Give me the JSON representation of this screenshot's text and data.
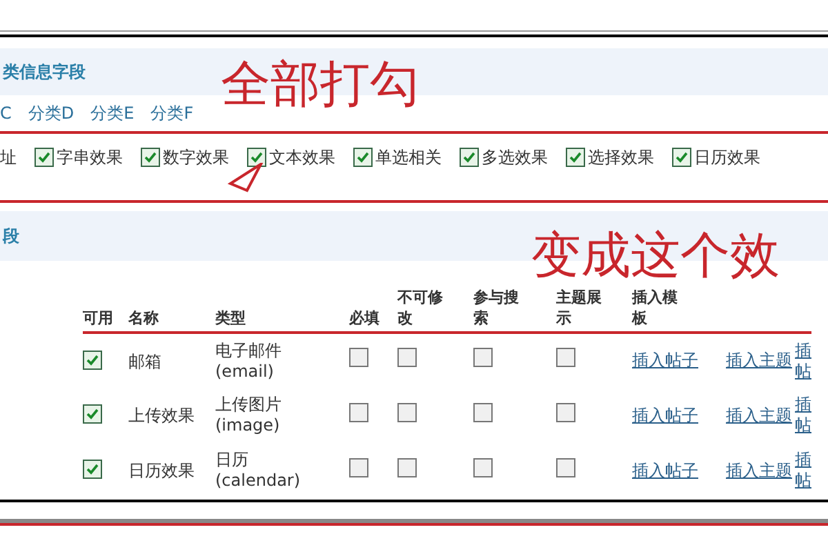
{
  "section1": {
    "title": "类信息字段",
    "tabs": [
      "C",
      "分类D",
      "分类E",
      "分类F"
    ],
    "lead_text": "址",
    "options": [
      {
        "label": "字串效果",
        "checked": true
      },
      {
        "label": "数字效果",
        "checked": true
      },
      {
        "label": "文本效果",
        "checked": true
      },
      {
        "label": "单选相关",
        "checked": true
      },
      {
        "label": "多选效果",
        "checked": true
      },
      {
        "label": "选择效果",
        "checked": true
      },
      {
        "label": "日历效果",
        "checked": true
      }
    ]
  },
  "annotation1": "全部打勾",
  "section2": {
    "title": "段"
  },
  "annotation2": "变成这个效",
  "table": {
    "columns": [
      "可用",
      "名称",
      "类型",
      "必填",
      "不可修改",
      "参与搜索",
      "主题展示",
      "插入模板"
    ],
    "rows": [
      {
        "enabled": true,
        "name": "邮箱",
        "type": "电子邮件(email)",
        "required": false,
        "readonly": false,
        "searchable": false,
        "show": false,
        "link1": "插入帖子",
        "link2": "插入主题",
        "column_10": "插帖"
      },
      {
        "enabled": true,
        "name": "上传效果",
        "type": "上传图片(image)",
        "required": false,
        "readonly": false,
        "searchable": false,
        "show": false,
        "link1": "插入帖子",
        "link2": "插入主题",
        "column_10": "插帖"
      },
      {
        "enabled": true,
        "name": "日历效果",
        "type": "日历(calendar)",
        "required": false,
        "readonly": false,
        "searchable": false,
        "show": false,
        "link1": "插入帖子",
        "link2": "插入主题",
        "column_10": "插帖"
      }
    ]
  }
}
